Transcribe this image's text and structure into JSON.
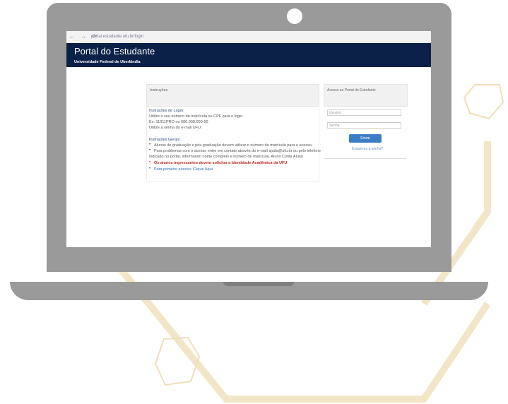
{
  "browser": {
    "nav_glyphs": "← → ⟳",
    "url": "portal.estudante.ufu.br/login"
  },
  "header": {
    "title": "Portal do Estudante",
    "subtitle": "Universidade Federal de Uberlândia"
  },
  "left_panel": {
    "title": "Instruções",
    "login_heading": "Instruções de Login:",
    "login_lines": [
      "Utilize o seu número de matrícula ou CPF para o login.",
      "Ex: 11011PRO ou 000.000.000-00",
      "Utilize a senha do e-mail UFU."
    ],
    "general_heading": "Instruções Gerais:",
    "general_items": [
      "Alunos de graduação e pós-graduação devem utilizar o número de matrícula para o acesso.",
      "Para problemas com o acesso entre em contato através do e-mail ajuda@ufu.br ou pelo telefone",
      "indicado no portal, informando nome completo e número de matrícula. Aluno Conta Aluno",
      "Os alunos ingressantes devem solicitar a Identidade Acadêmica da UFU",
      "Para primeiro acesso: Clique Aqui"
    ],
    "first_access_link": "Clique Aqui"
  },
  "right_panel": {
    "title": "Acesso ao Portal do Estudante",
    "user_placeholder": "Usuário",
    "pass_placeholder": "Senha",
    "login_button": "Entrar",
    "forgot_link": "Esqueceu a senha?"
  },
  "colors": {
    "header_bg": "#0b2148",
    "button_bg": "#3c7ec4",
    "alert_text": "#c62828",
    "laptop_body": "#9a9a9a",
    "hex_outline": "#eedfb8"
  }
}
